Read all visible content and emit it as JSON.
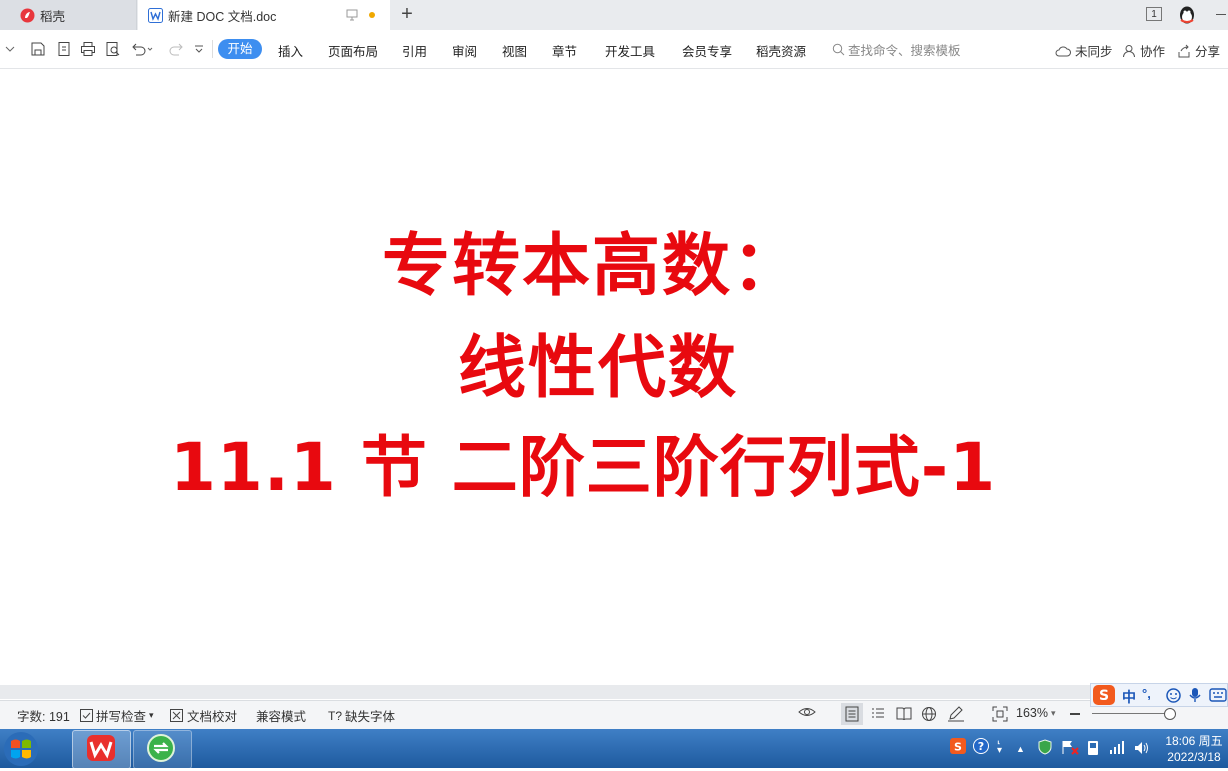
{
  "tabs": {
    "daoke": "稻壳",
    "doc": "新建 DOC 文档.doc",
    "add": "+",
    "window_count": "1"
  },
  "menu": [
    "开始",
    "插入",
    "页面布局",
    "引用",
    "审阅",
    "视图",
    "章节",
    "开发工具",
    "会员专享",
    "稻壳资源"
  ],
  "search_placeholder": "查找命令、搜索模板",
  "right_actions": {
    "sync": "未同步",
    "collab": "协作",
    "share": "分享"
  },
  "document": {
    "line1": "专转本高数：",
    "line2": "线性代数",
    "line3": "11.1 节  二阶三阶行列式-1"
  },
  "status": {
    "word_count": "字数: 191",
    "spell_check": "拼写检查",
    "doc_check": "文档校对",
    "compat_mode": "兼容模式",
    "missing_font": "缺失字体",
    "zoom": "163%",
    "zoom_percent": 163
  },
  "ime": {
    "lang": "中",
    "punct": "°,"
  },
  "clock": {
    "time": "18:06 周五",
    "date": "2022/3/18"
  },
  "colors": {
    "accent": "#3d8ef0",
    "title_red": "#e8090f",
    "taskbar": "#2a6bb3"
  }
}
